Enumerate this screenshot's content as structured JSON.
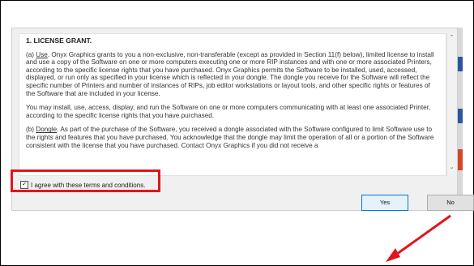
{
  "license": {
    "heading": "1. LICENSE GRANT.",
    "para1_term": "Use",
    "para1_prefix": "(a) ",
    "para1_body": ". Onyx Graphics grants to you a non-exclusive, non-transferable (except as provided in Section 11(f) below), limited license to install and use a copy of the Software on one or more computers executing one or more RIP instances and with one or more associated Printers, according to the specific license rights that you have purchased. Onyx Graphics permits the Software to be installed, used, accessed, displayed, or run only as specified in your license which is reflected in your dongle. The dongle you receive for the Software will reflect the specific number of Printers and number of instances of RIPs, job editor workstations or layout tools, and other specific rights or features of the Software that are included in your license.",
    "para2": "You may install, use, access, display, and run the Software on one or more computers communicating with at least one associated Printer, according to the specific license rights that you have purchased.",
    "para3_prefix": "(b) ",
    "para3_term": "Dongle",
    "para3_body": ". As part of the purchase of the Software, you received a dongle associated with the Software configured to limit Software use to the rights and features that you have purchased. You acknowledge that the dongle may limit the operation of all or a portion of the Software consistent with the license that you have purchased. Contact Onyx Graphics if you did not receive a"
  },
  "agree": {
    "label": "I agree with these terms and conditions.",
    "checked": "✓"
  },
  "buttons": {
    "yes": "Yes",
    "no": "No"
  },
  "colors": {
    "annotation": "#e0161c"
  }
}
